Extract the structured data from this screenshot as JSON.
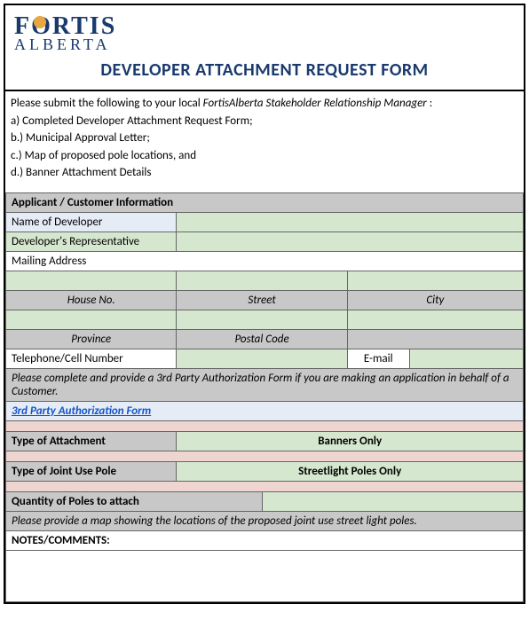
{
  "logo": {
    "line1": "FORTIS",
    "line2": "ALBERTA"
  },
  "title": "DEVELOPER ATTACHMENT REQUEST FORM",
  "intro": {
    "lead_a": "Please submit the following to your local ",
    "lead_b": "FortisAlberta Stakeholder Relationship Manager",
    "lead_c": " :",
    "a": "a) Completed Developer Attachment Request Form;",
    "b": "b.) Municipal Approval Letter;",
    "c": "c.) Map of proposed pole locations, and",
    "d": "d.) Banner Attachment Details"
  },
  "applicant": {
    "header": "Applicant / Customer Information",
    "name_label": "Name of Developer",
    "rep_label": "Developer's Representative",
    "mailing_label": "Mailing Address",
    "house_no": "House No.",
    "street": "Street",
    "city": "City",
    "province": "Province",
    "postal": "Postal Code",
    "phone_label": "Telephone/Cell Number",
    "email_label": "E-mail",
    "note": "Please complete and provide a 3rd Party Authorization Form if you are making an application in behalf of a Customer.",
    "link_text": "3rd Party Authorization Form"
  },
  "attachment": {
    "type_label": "Type of Attachment",
    "type_value": "Banners Only",
    "pole_label": "Type of Joint Use Pole",
    "pole_value": "Streetlight Poles Only",
    "qty_label": "Quantity of Poles to attach",
    "map_note": "Please provide a map showing the locations of the proposed joint use street light poles."
  },
  "notes": {
    "header": "NOTES/COMMENTS:"
  }
}
